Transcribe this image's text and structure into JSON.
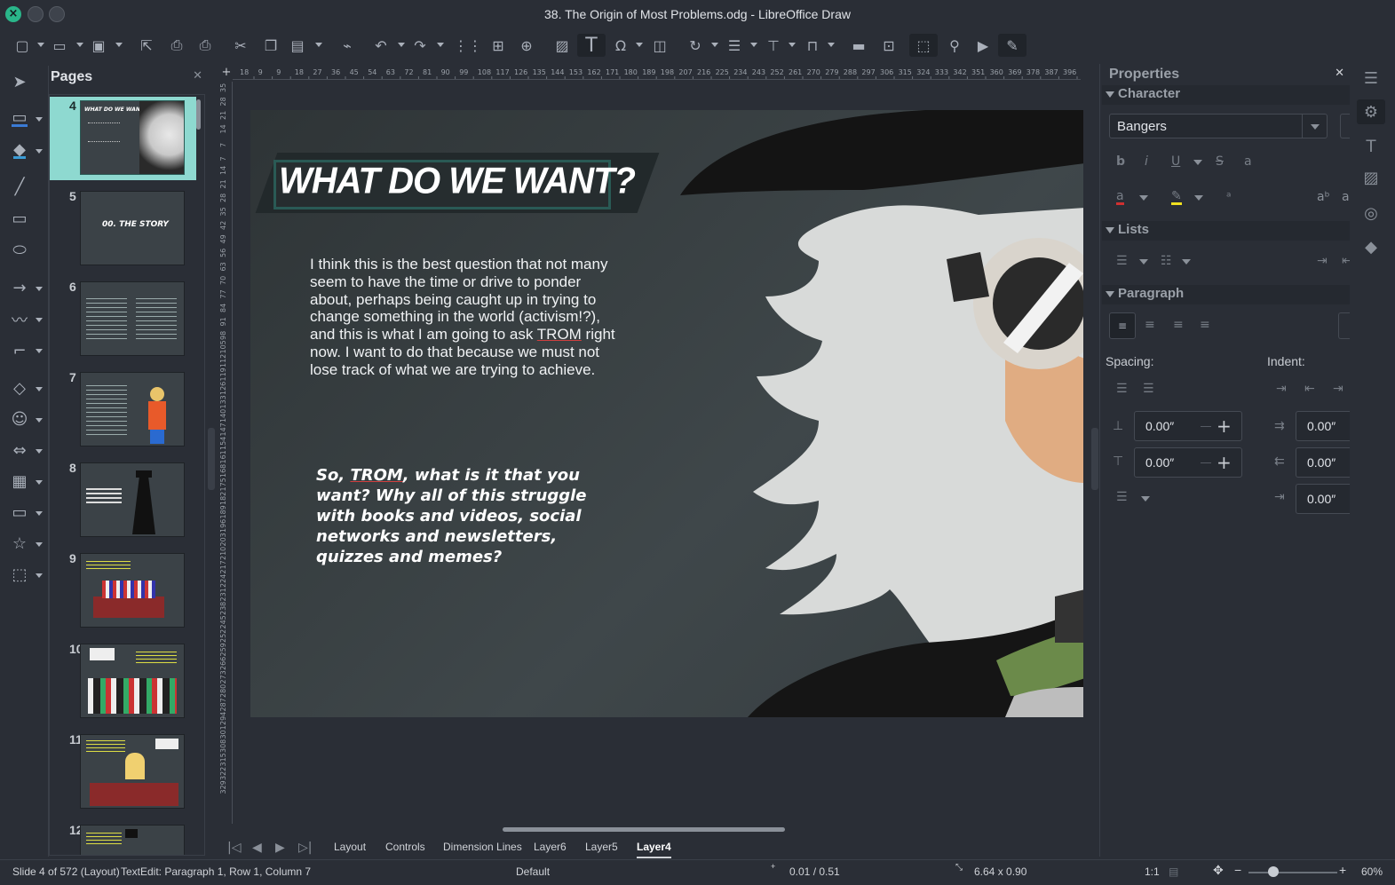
{
  "window": {
    "title": "38. The Origin of Most Problems.odg - LibreOffice Draw"
  },
  "pages_panel": {
    "title": "Pages",
    "thumbnails": [
      {
        "number": "4",
        "caption": "WHAT DO WE WANT?"
      },
      {
        "number": "5",
        "caption": "00. THE STORY"
      },
      {
        "number": "6",
        "caption": ""
      },
      {
        "number": "7",
        "caption": ""
      },
      {
        "number": "8",
        "caption": ""
      },
      {
        "number": "9",
        "caption": ""
      },
      {
        "number": "10",
        "caption": ""
      },
      {
        "number": "11",
        "caption": ""
      },
      {
        "number": "12",
        "caption": ""
      }
    ]
  },
  "ruler": {
    "h_ticks": [
      "18",
      "9",
      "9",
      "18",
      "27",
      "36",
      "45",
      "54",
      "63",
      "72",
      "81",
      "90",
      "99",
      "108",
      "117",
      "126",
      "135",
      "144",
      "153",
      "162",
      "171",
      "180",
      "189",
      "198",
      "207",
      "216",
      "225",
      "234",
      "243",
      "252",
      "261",
      "270",
      "279",
      "288",
      "297",
      "306",
      "315",
      "324",
      "333",
      "342",
      "351",
      "360",
      "369",
      "378",
      "387",
      "396"
    ],
    "v_ticks": [
      "35",
      "28",
      "21",
      "14",
      "7",
      "7",
      "14",
      "21",
      "28",
      "35",
      "42",
      "49",
      "56",
      "63",
      "70",
      "77",
      "84",
      "91",
      "98",
      "105",
      "112",
      "119",
      "126",
      "133",
      "140",
      "147",
      "154",
      "161",
      "168",
      "175",
      "182",
      "189",
      "196",
      "203",
      "210",
      "217",
      "224",
      "231",
      "238",
      "245",
      "252",
      "259",
      "266",
      "273",
      "280",
      "287",
      "294",
      "301",
      "308",
      "315",
      "322",
      "329"
    ]
  },
  "slide": {
    "title": "WHAT DO WE WANT?",
    "body1_before": "I think this is the best question that not many seem to have the time or drive to ponder about, perhaps being caught up in trying to change something in the world (activism!?), and this is what I am going to ask ",
    "body1_link": "TROM",
    "body1_after": " right now. I want to do that because we must not lose track of what we are trying to achieve.",
    "body2_before": "So, ",
    "body2_link": "TROM",
    "body2_after": ", what is it that you want? Why all of this struggle with books and videos, social networks and newsletters, quizzes and memes?"
  },
  "layer_tabs": [
    "Layout",
    "Controls",
    "Dimension Lines",
    "Layer6",
    "Layer5",
    "Layer4"
  ],
  "active_layer": "Layer4",
  "status": {
    "slide": "Slide 4 of 572 (Layout)",
    "edit": "TextEdit: Paragraph 1, Row 1, Column 7",
    "style": "Default",
    "position": "0.01 / 0.51",
    "size": "6.64 x 0.90",
    "scale": "1:1",
    "zoom": "60%"
  },
  "properties": {
    "title": "Properties",
    "character_label": "Character",
    "font_name": "Bangers",
    "lists_label": "Lists",
    "paragraph_label": "Paragraph",
    "spacing_label": "Spacing:",
    "indent_label": "Indent:",
    "above_spacing": "0.00″",
    "below_spacing": "0.00″",
    "before_indent": "0.00″",
    "after_indent": "0.00″",
    "first_line_indent": "0.00″"
  },
  "colors": {
    "accent": "#8ed9d0",
    "font_color": "#d03030",
    "highlight": "#f0e020"
  }
}
